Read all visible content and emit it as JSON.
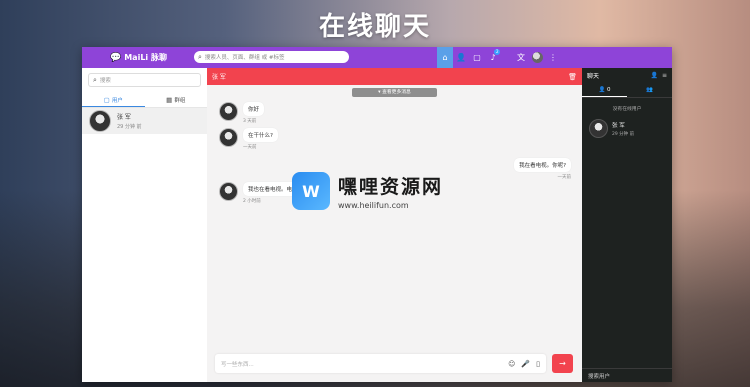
{
  "headline": "在线聊天",
  "topbar": {
    "brand": "MaiLi 脉聊",
    "search_placeholder": "搜索人员、页面、群组 或 #标签",
    "badge": "2",
    "lang": "文"
  },
  "left": {
    "search_placeholder": "搜索",
    "tabs": [
      {
        "label": "用户"
      },
      {
        "label": "群组"
      }
    ],
    "contacts": [
      {
        "name": "张 军",
        "time": "29 分钟 前"
      }
    ]
  },
  "chat": {
    "title": "张 军",
    "load_more": "查看更多消息",
    "messages": [
      {
        "text": "你好",
        "time": "3 天前",
        "side": "left"
      },
      {
        "text": "在干什么?",
        "time": "一天前",
        "side": "left"
      },
      {
        "text": "我在看电视。你呢?",
        "time": "一天前",
        "side": "right"
      },
      {
        "text": "我也在看电视。电",
        "time": "2 小时前",
        "side": "left"
      }
    ],
    "input_placeholder": "写一些东西..."
  },
  "right": {
    "title": "聊天",
    "tab_online_count": "0",
    "no_online": "没有在线用户",
    "contacts": [
      {
        "name": "张 军",
        "time": "29 分钟 前"
      }
    ],
    "search_label": "搜索用户"
  },
  "watermark": {
    "name": "嘿哩资源网",
    "url": "www.heilifun.com"
  },
  "colors": {
    "topbar": "#8e44d8",
    "chat_header": "#f2434e",
    "right_panel": "#1e2220",
    "accent_blue": "#3a88e0"
  }
}
